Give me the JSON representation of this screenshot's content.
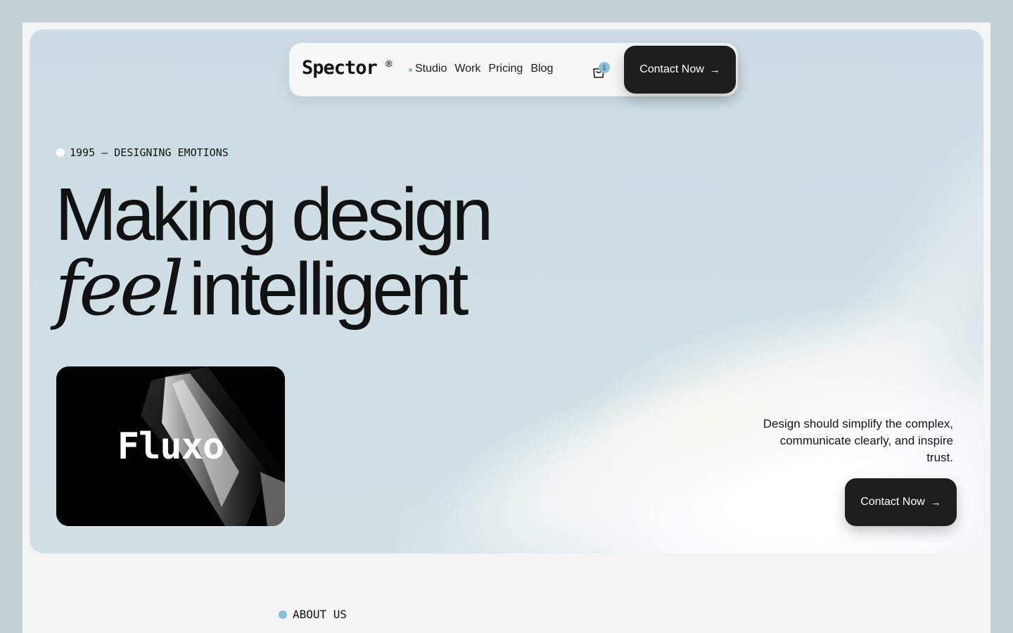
{
  "nav": {
    "logo": "Spector",
    "logo_mark": "®",
    "links": [
      "Studio",
      "Work",
      "Pricing",
      "Blog"
    ],
    "cart_count": "1",
    "contact_label": "Contact Now",
    "cart_icon": "shopping-bag-icon",
    "arrow_icon": "arrow-right-icon"
  },
  "hero": {
    "eyebrow": "1995 — DESIGNING EMOTIONS",
    "headline_line1": "Making design",
    "headline_italic": "feel",
    "headline_rest": "intelligent",
    "media_label": "Fluxo",
    "tagline": "Design should simplify the complex, communicate clearly, and inspire trust.",
    "contact_label": "Contact Now"
  },
  "about": {
    "label": "ABOUT US"
  },
  "colors": {
    "accent_blue": "#8cbfd8",
    "dark_button": "#1e1e1e",
    "hero_bg": "#cddbe4",
    "page_bg": "#f4f4f4",
    "outer_bg": "#c3d0d3"
  }
}
